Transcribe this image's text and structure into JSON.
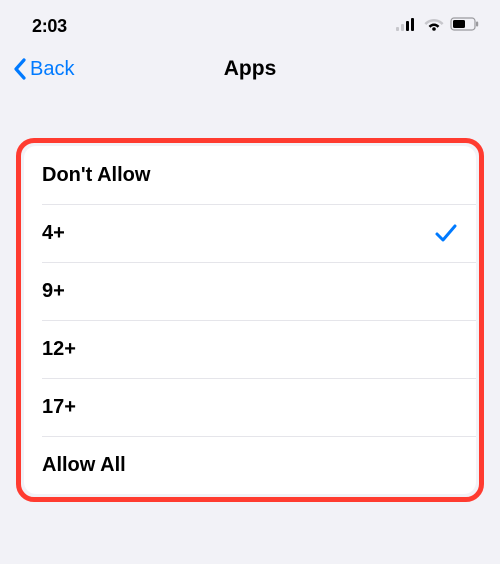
{
  "status": {
    "time": "2:03"
  },
  "nav": {
    "back_label": "Back",
    "title": "Apps"
  },
  "options": [
    {
      "id": "dont-allow",
      "label": "Don't Allow",
      "selected": false
    },
    {
      "id": "4plus",
      "label": "4+",
      "selected": true
    },
    {
      "id": "9plus",
      "label": "9+",
      "selected": false
    },
    {
      "id": "12plus",
      "label": "12+",
      "selected": false
    },
    {
      "id": "17plus",
      "label": "17+",
      "selected": false
    },
    {
      "id": "allow-all",
      "label": "Allow All",
      "selected": false
    }
  ],
  "colors": {
    "accent": "#007aff",
    "highlight_border": "#ff3b30",
    "background": "#f2f2f7"
  }
}
